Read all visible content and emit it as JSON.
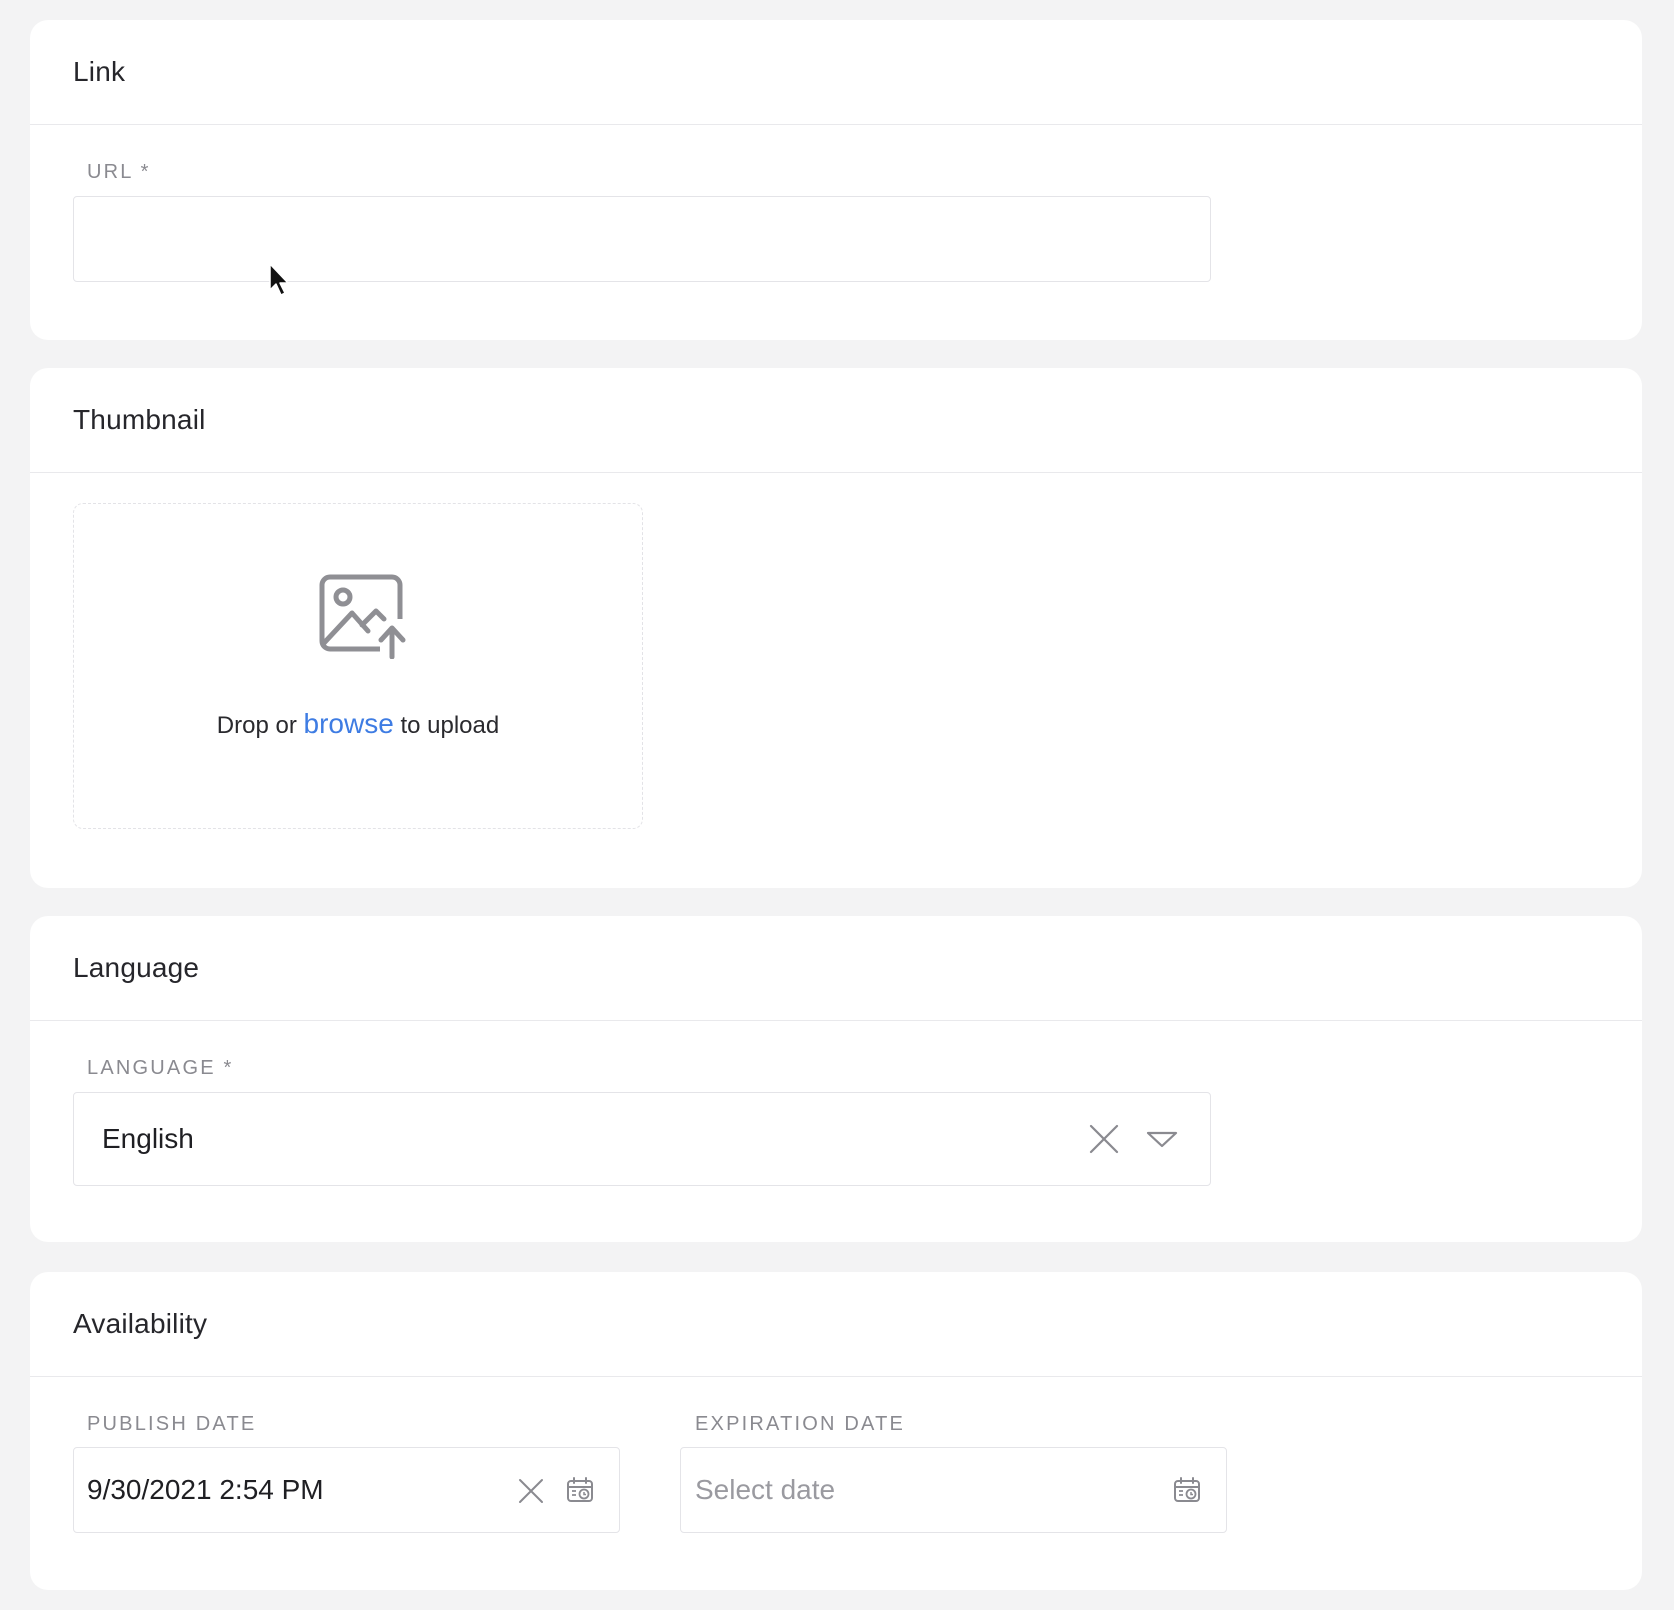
{
  "link_section": {
    "title": "Link",
    "url_label": "URL *",
    "url_value": ""
  },
  "thumbnail_section": {
    "title": "Thumbnail",
    "drop_prefix": "Drop or",
    "browse_label": "browse",
    "drop_suffix": "to upload",
    "icon": "image-upload-icon"
  },
  "language_section": {
    "title": "Language",
    "language_label": "LANGUAGE *",
    "language_value": "English",
    "icons": [
      "clear-icon",
      "chevron-down-icon"
    ]
  },
  "availability_section": {
    "title": "Availability",
    "publish_label": "PUBLISH DATE",
    "publish_value": "9/30/2021 2:54 PM",
    "expiration_label": "EXPIRATION DATE",
    "expiration_placeholder": "Select date",
    "icons": [
      "clear-icon",
      "calendar-icon"
    ]
  },
  "colors": {
    "background": "#f3f3f4",
    "card": "#ffffff",
    "link_accent": "#3e7ce3",
    "label": "#8a8a90",
    "border": "#e4e4e8"
  }
}
